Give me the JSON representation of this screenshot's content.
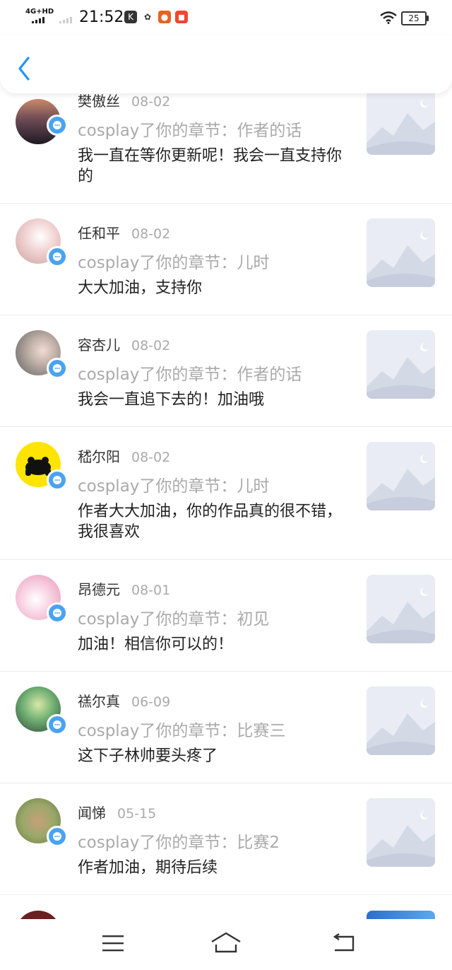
{
  "status": {
    "network": "4G+HD",
    "time": "21:52",
    "battery": "25"
  },
  "header": {
    "back_icon": "chevron-left-icon",
    "accent": "#2196f3"
  },
  "items": [
    {
      "name": "樊傲丝",
      "date": "08-02",
      "subject": "cosplay了你的章节：作者的话",
      "message": "我一直在等你更新呢！我会一直支持你的",
      "avatar_color": "#3a2a33"
    },
    {
      "name": "任和平",
      "date": "08-02",
      "subject": "cosplay了你的章节：儿时",
      "message": "大大加油，支持你",
      "avatar_color": "#d9b3b3"
    },
    {
      "name": "容杏儿",
      "date": "08-02",
      "subject": "cosplay了你的章节：作者的话",
      "message": "我会一直追下去的！加油哦",
      "avatar_color": "#7a7a7a"
    },
    {
      "name": "嵇尔阳",
      "date": "08-02",
      "subject": "cosplay了你的章节：儿时",
      "message": "作者大大加油，你的作品真的很不错，我很喜欢",
      "avatar_color": "#ffe400"
    },
    {
      "name": "昂德元",
      "date": "08-01",
      "subject": "cosplay了你的章节：初见",
      "message": "加油！相信你可以的！",
      "avatar_color": "#f0b5c8"
    },
    {
      "name": "禚尔真",
      "date": "06-09",
      "subject": "cosplay了你的章节：比赛三",
      "message": "这下子林帅要头疼了",
      "avatar_color": "#5f8f5a"
    },
    {
      "name": "闻悌",
      "date": "05-15",
      "subject": "cosplay了你的章节：比赛2",
      "message": "作者加油，期待后续",
      "avatar_color": "#9aa86a"
    }
  ],
  "bottom_nav": [
    "menu-icon",
    "home-icon",
    "back-icon"
  ]
}
